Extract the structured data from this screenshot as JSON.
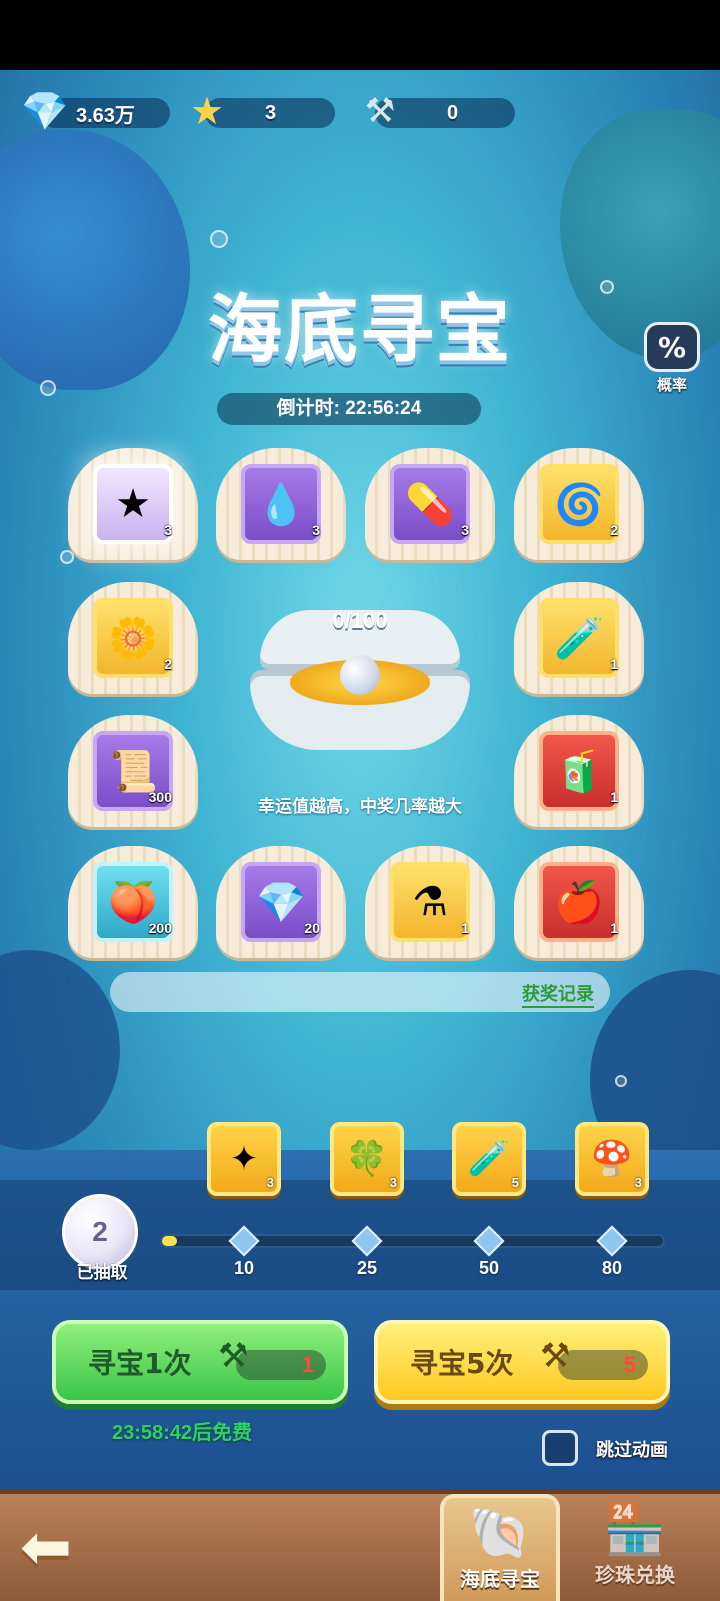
{
  "currency": {
    "gems": "3.63万",
    "starfish": "3",
    "rakes": "0"
  },
  "title": "海底寻宝",
  "countdown": "倒计时: 22:56:24",
  "probability_label": "概率",
  "prizes": [
    {
      "icon": "starfish",
      "count": "3",
      "tone": "pearl"
    },
    {
      "icon": "golden-drop",
      "count": "3",
      "tone": "purple"
    },
    {
      "icon": "purple-capsule",
      "count": "3",
      "tone": "purple"
    },
    {
      "icon": "rune-stone",
      "count": "2",
      "tone": "gold"
    },
    {
      "icon": "golden-flower",
      "count": "2",
      "tone": "gold"
    },
    {
      "icon": "red-potion",
      "count": "1",
      "tone": "gold"
    },
    {
      "icon": "scroll-bundle",
      "count": "300",
      "tone": "purple"
    },
    {
      "icon": "green-capsule",
      "count": "1",
      "tone": "red"
    },
    {
      "icon": "rainbow-fruit",
      "count": "200",
      "tone": "blue"
    },
    {
      "icon": "blue-crystal",
      "count": "20",
      "tone": "purple"
    },
    {
      "icon": "teal-potion",
      "count": "1",
      "tone": "gold"
    },
    {
      "icon": "red-fruit-bottle",
      "count": "1",
      "tone": "red"
    }
  ],
  "luck": {
    "progress": "0/100",
    "tip": "幸运值越高，中奖几率越大"
  },
  "record_link": "获奖记录",
  "draws": {
    "count": "2",
    "label": "已抽取",
    "progress_fraction": 0.02
  },
  "milestones": [
    {
      "threshold": "10",
      "reward_icon": "star-compass",
      "count": "3"
    },
    {
      "threshold": "25",
      "reward_icon": "gold-leaf-gem",
      "count": "3"
    },
    {
      "threshold": "50",
      "reward_icon": "orange-potion",
      "count": "5"
    },
    {
      "threshold": "80",
      "reward_icon": "blue-mushroom",
      "count": "3"
    }
  ],
  "actions": {
    "single": {
      "label": "寻宝1次",
      "cost": "1"
    },
    "five": {
      "label": "寻宝5次",
      "cost": "5"
    },
    "free_timer": "23:58:42后免费",
    "skip_animation": "跳过动画"
  },
  "nav": {
    "tab_treasure": "海底寻宝",
    "tab_pearl_exchange": "珍珠兑换"
  },
  "colors": {
    "sea_top": "#6fd8e8",
    "sea_bottom": "#1f5f9a",
    "green_button": "#3bc44a",
    "yellow_button": "#ffc821",
    "free_timer": "#2fd06a",
    "cost_red": "#ff4a3a"
  }
}
